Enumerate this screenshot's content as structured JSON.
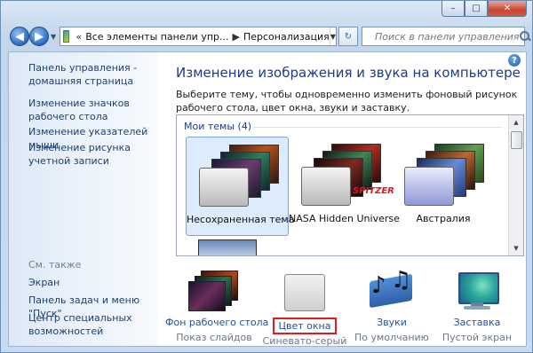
{
  "window": {
    "caption_buttons": {
      "minimize": "–",
      "maximize": "□",
      "close": "✕"
    }
  },
  "nav": {
    "breadcrumb": [
      "Все элементы панели упр...",
      "Персонализация"
    ],
    "search_placeholder": "Поиск в панели управления"
  },
  "sidebar": {
    "links": [
      "Панель управления - домашняя страница",
      "Изменение значков рабочего стола",
      "Изменение указателей мыши",
      "Изменение рисунка учетной записи"
    ],
    "see_also_label": "См. также",
    "see_also": [
      "Экран",
      "Панель задач и меню \"Пуск\"",
      "Центр специальных возможностей"
    ]
  },
  "main": {
    "title": "Изменение изображения и звука на компьютере",
    "description": "Выберите тему, чтобы одновременно изменить фоновый рисунок рабочего стола, цвет окна, звуки и заставку.",
    "group_label": "Мои темы (4)",
    "themes": [
      {
        "name": "Несохраненная тема",
        "selected": true
      },
      {
        "name": "NASA Hidden Universe",
        "selected": false,
        "badge": "SPITZER"
      },
      {
        "name": "Австралия",
        "selected": false
      }
    ]
  },
  "bottom": [
    {
      "label": "Фон рабочего стола",
      "sub": "Показ слайдов",
      "icon": "wallpaper-icon"
    },
    {
      "label": "Цвет окна",
      "sub": "Синевато-серый",
      "icon": "window-color-icon",
      "highlighted": true
    },
    {
      "label": "Звуки",
      "sub": "По умолчанию",
      "icon": "sounds-icon"
    },
    {
      "label": "Заставка",
      "sub": "Пустой экран",
      "icon": "screensaver-icon"
    }
  ],
  "colors": {
    "highlight": "#e41b1b",
    "link": "#1e50a8",
    "title": "#1e3a8a"
  }
}
